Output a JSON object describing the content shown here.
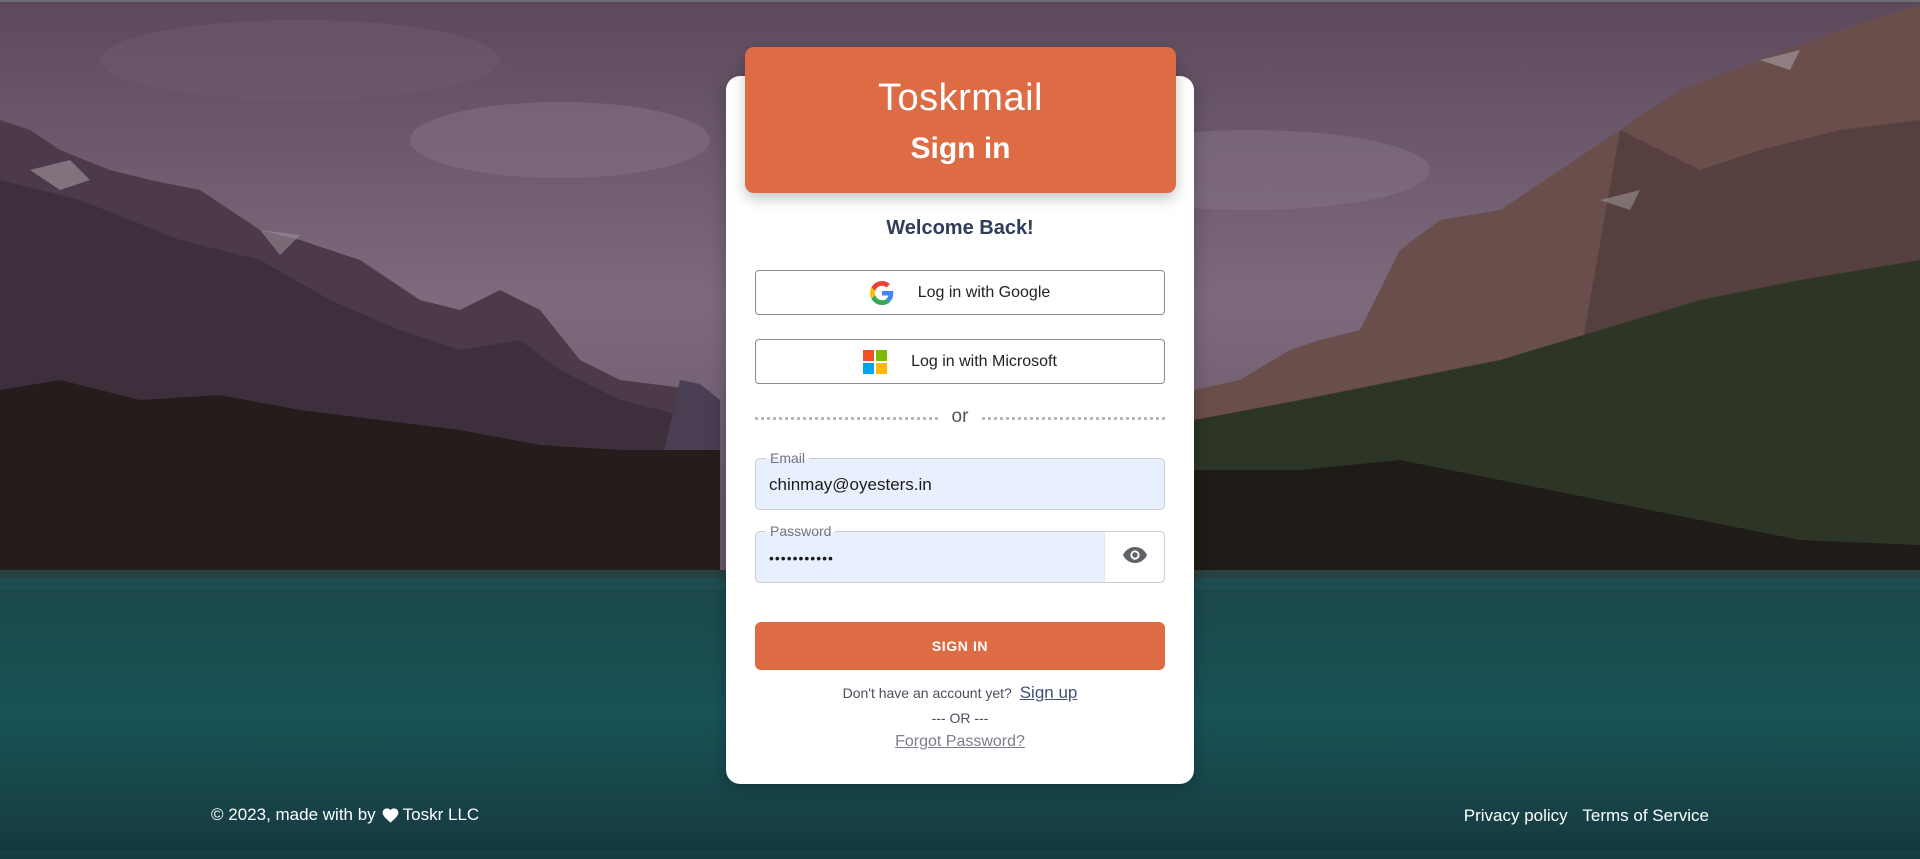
{
  "header": {
    "brand": "Toskrmail",
    "title": "Sign in"
  },
  "welcome": "Welcome Back!",
  "oauth": {
    "google_label": "Log in with Google",
    "google_icon": "google-g-icon",
    "microsoft_label": "Log in with Microsoft",
    "microsoft_icon": "microsoft-logo-icon"
  },
  "divider": {
    "text": "or"
  },
  "form": {
    "email": {
      "label": "Email",
      "value": "chinmay@oyesters.in"
    },
    "password": {
      "label": "Password",
      "value": "•••••••••••",
      "toggle_icon": "eye-icon"
    },
    "submit_label": "SIGN IN"
  },
  "signup": {
    "prompt": "Don't have an account yet?",
    "link": "Sign up"
  },
  "or_separator": "--- OR ---",
  "forgot_password": "Forgot Password?",
  "footer": {
    "copyright_prefix": "© 2023, made with by",
    "heart_icon": "heart-icon",
    "company": "Toskr LLC",
    "privacy": "Privacy policy",
    "terms": "Terms of Service"
  },
  "colors": {
    "accent": "#dd6b43",
    "input_bg": "#e8f0fe",
    "text_dark": "#2e3d5a"
  }
}
